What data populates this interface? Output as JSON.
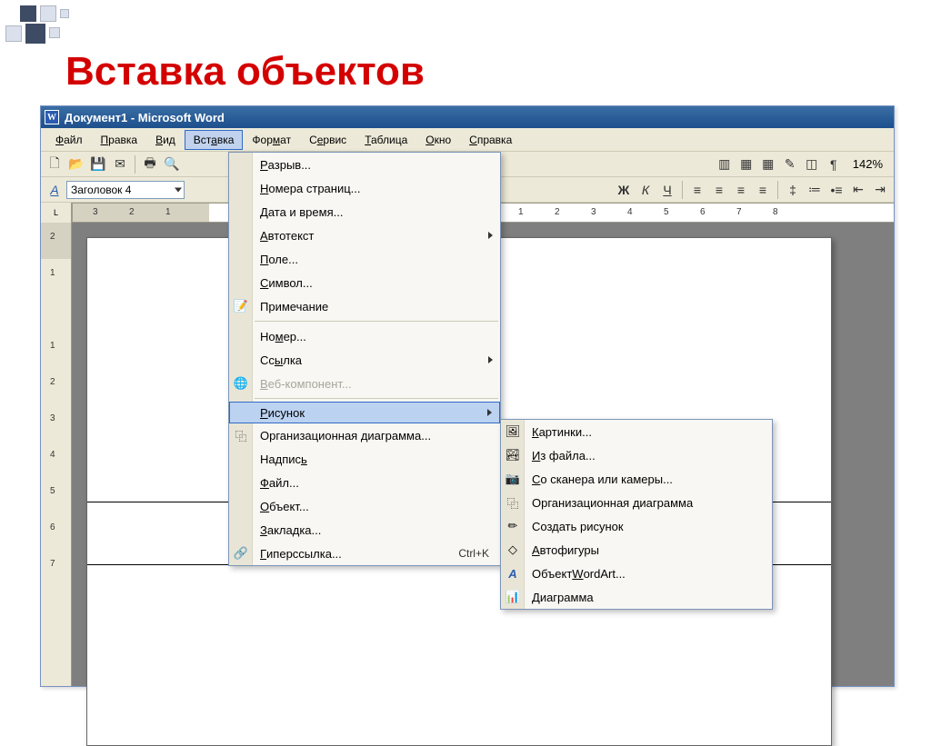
{
  "slide": {
    "title": "Вставка объектов"
  },
  "window": {
    "title": "Документ1 - Microsoft Word"
  },
  "menubar": {
    "items": [
      {
        "label": "Файл",
        "ukey": "Ф"
      },
      {
        "label": "Правка",
        "ukey": "П"
      },
      {
        "label": "Вид",
        "ukey": "В"
      },
      {
        "label": "Вставка",
        "ukey": "а",
        "active": true
      },
      {
        "label": "Формат",
        "ukey": "м"
      },
      {
        "label": "Сервис",
        "ukey": "е"
      },
      {
        "label": "Таблица",
        "ukey": "Т"
      },
      {
        "label": "Окно",
        "ukey": "О"
      },
      {
        "label": "Справка",
        "ukey": "С"
      }
    ]
  },
  "toolbar": {
    "zoom": "142%",
    "style_combo": "Заголовок 4",
    "bold": "Ж",
    "italic": "К",
    "underline": "Ч"
  },
  "ruler": {
    "hticks": [
      "3",
      "2",
      "1",
      "1",
      "2",
      "3",
      "4",
      "5",
      "6",
      "7",
      "8"
    ],
    "vticks": [
      "2",
      "1",
      "1",
      "2",
      "3",
      "4",
      "5",
      "6",
      "7"
    ]
  },
  "insert_menu": {
    "items": [
      {
        "label": "Разрыв...",
        "ukey": "Р"
      },
      {
        "label": "Номера страниц...",
        "ukey": "Н"
      },
      {
        "label": "Дата и время...",
        "ukey": "Д"
      },
      {
        "label": "Автотекст",
        "ukey": "А",
        "submenu": true
      },
      {
        "label": "Поле...",
        "ukey": "П"
      },
      {
        "label": "Символ...",
        "ukey": "С"
      },
      {
        "label": "Примечание",
        "icon": "note"
      },
      {
        "sep": true
      },
      {
        "label": "Номер...",
        "ukey": "м"
      },
      {
        "label": "Ссылка",
        "ukey": "ы",
        "submenu": true
      },
      {
        "label": "Веб-компонент...",
        "ukey": "В",
        "disabled": true,
        "icon": "web"
      },
      {
        "sep": true
      },
      {
        "label": "Рисунок",
        "ukey": "Р",
        "submenu": true,
        "hover": true
      },
      {
        "label": "Организационная диаграмма...",
        "icon": "org"
      },
      {
        "label": "Надпись",
        "ukey": "ь"
      },
      {
        "label": "Файл...",
        "ukey": "Ф"
      },
      {
        "label": "Объект...",
        "ukey": "О"
      },
      {
        "label": "Закладка...",
        "ukey": "З"
      },
      {
        "label": "Гиперссылка...",
        "ukey": "Г",
        "shortcut": "Ctrl+K",
        "icon": "link"
      }
    ]
  },
  "picture_submenu": {
    "items": [
      {
        "label": "Картинки...",
        "ukey": "К",
        "icon": "clip"
      },
      {
        "label": "Из файла...",
        "ukey": "И",
        "icon": "img"
      },
      {
        "label": "Со сканера или камеры...",
        "ukey": "С",
        "icon": "scan"
      },
      {
        "label": "Организационная диаграмма",
        "icon": "org2"
      },
      {
        "label": "Создать рисунок",
        "icon": "draw"
      },
      {
        "label": "Автофигуры",
        "ukey": "А",
        "icon": "shapes"
      },
      {
        "label": "Объект WordArt...",
        "ukey": "W",
        "icon": "wordart"
      },
      {
        "label": "Диаграмма",
        "ukey": "Д",
        "icon": "chart"
      }
    ]
  }
}
